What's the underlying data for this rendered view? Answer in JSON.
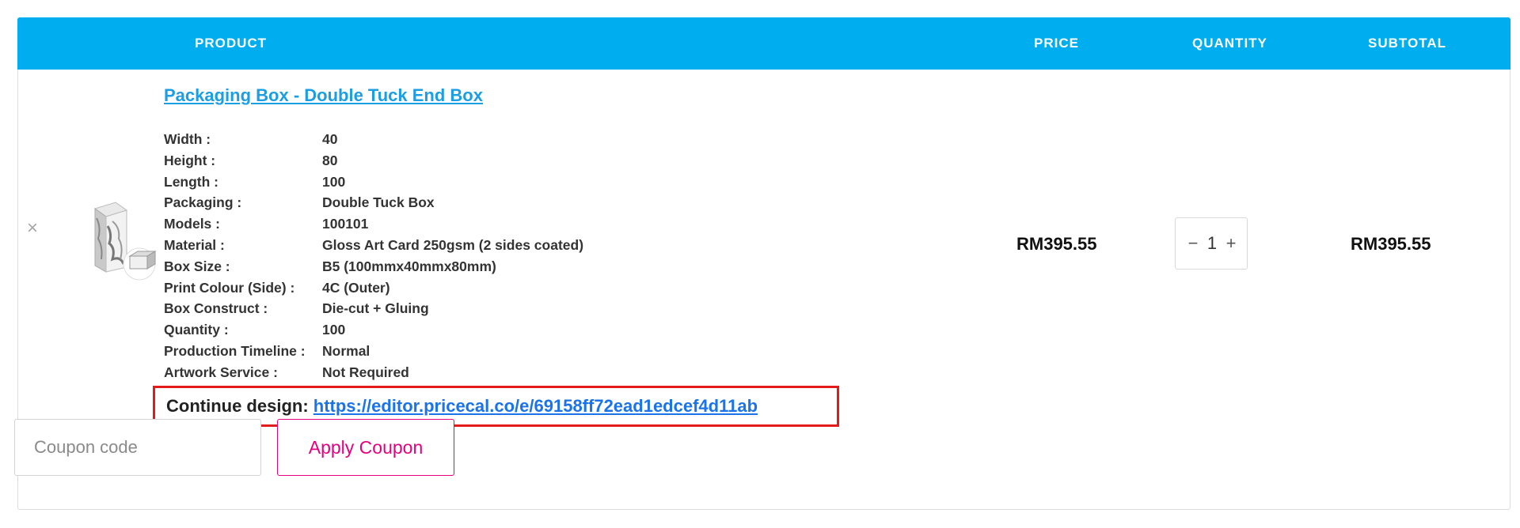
{
  "header": {
    "product": "PRODUCT",
    "price": "PRICE",
    "quantity": "QUANTITY",
    "subtotal": "SUBTOTAL"
  },
  "item": {
    "remove_symbol": "×",
    "thumbnail_icon": "box-product-thumbnail",
    "title": "Packaging Box - Double Tuck End Box",
    "specs": [
      {
        "label": "Width :",
        "value": "40"
      },
      {
        "label": "Height :",
        "value": "80"
      },
      {
        "label": "Length :",
        "value": "100"
      },
      {
        "label": "Packaging :",
        "value": "Double Tuck Box"
      },
      {
        "label": "Models :",
        "value": "100101"
      },
      {
        "label": "Material :",
        "value": "Gloss Art Card 250gsm (2 sides coated)"
      },
      {
        "label": "Box Size :",
        "value": "B5 (100mmx40mmx80mm)"
      },
      {
        "label": "Print Colour (Side) :",
        "value": "4C (Outer)"
      },
      {
        "label": "Box Construct :",
        "value": "Die-cut + Gluing"
      },
      {
        "label": "Quantity :",
        "value": "100"
      },
      {
        "label": "Production Timeline :",
        "value": "Normal"
      },
      {
        "label": "Artwork Service :",
        "value": "Not Required"
      }
    ],
    "continue_label": "Continue design: ",
    "continue_url": "https://editor.pricecal.co/e/69158ff72ead1edcef4d11ab",
    "price": "RM395.55",
    "quantity": "1",
    "qty_minus": "−",
    "qty_plus": "+",
    "subtotal": "RM395.55"
  },
  "coupon": {
    "placeholder": "Coupon code",
    "apply_label": "Apply Coupon"
  },
  "colors": {
    "header_bg": "#00aeef",
    "link": "#1b9ee3",
    "accent": "#e6007e",
    "highlight": "#e31b1b"
  }
}
